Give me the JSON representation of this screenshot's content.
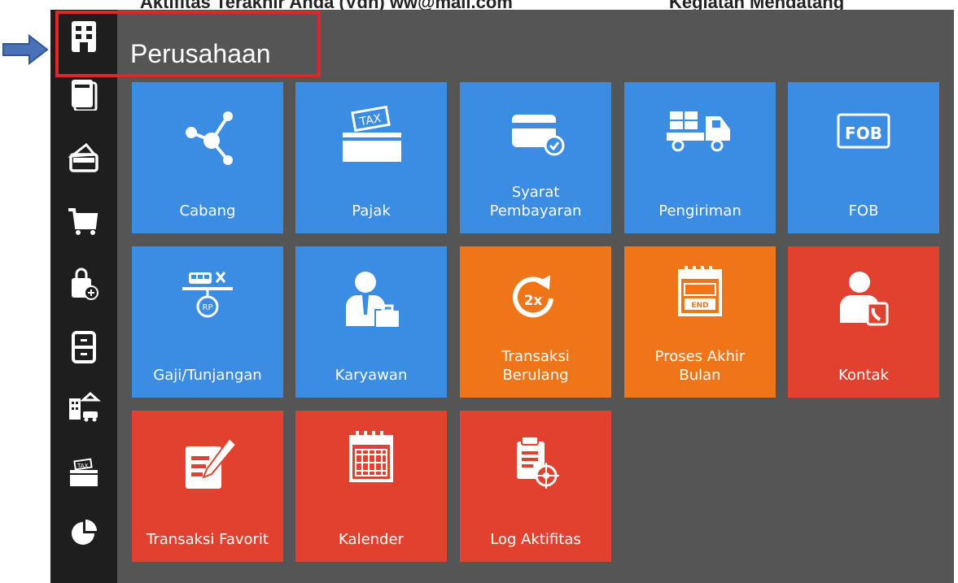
{
  "top_strip": {
    "left_text": "Aktifitas Terakhir Anda (Vdn) ww@mail.com",
    "right_text": "Kegiatan Mendatang"
  },
  "header": {
    "title": "Perusahaan"
  },
  "sidebar": {
    "items": [
      {
        "icon": "building-icon"
      },
      {
        "icon": "ledger-icon"
      },
      {
        "icon": "wallet-icon"
      },
      {
        "icon": "cart-icon"
      },
      {
        "icon": "shopping-bag-add-icon"
      },
      {
        "icon": "cabinet-icon"
      },
      {
        "icon": "fixed-asset-icon"
      },
      {
        "icon": "tax-icon"
      },
      {
        "icon": "pie-chart-icon"
      }
    ]
  },
  "tiles": [
    {
      "label": "Cabang",
      "icon": "share-nodes-icon",
      "color": "#3a8de2"
    },
    {
      "label": "Pajak",
      "icon": "tax-icon",
      "color": "#3a8de2"
    },
    {
      "label": "Syarat Pembayaran",
      "icon": "card-check-icon",
      "color": "#3a8de2"
    },
    {
      "label": "Pengiriman",
      "icon": "truck-icon",
      "color": "#3a8de2"
    },
    {
      "label": "FOB",
      "icon": "fob-icon",
      "color": "#3a8de2"
    },
    {
      "label": "Gaji/Tunjangan",
      "icon": "salary-icon",
      "color": "#3a8de2"
    },
    {
      "label": "Karyawan",
      "icon": "employee-icon",
      "color": "#3a8de2"
    },
    {
      "label": "Transaksi Berulang",
      "icon": "recurring-icon",
      "color": "#f07418"
    },
    {
      "label": "Proses Akhir Bulan",
      "icon": "month-end-icon",
      "color": "#f07418"
    },
    {
      "label": "Kontak",
      "icon": "contact-icon",
      "color": "#e2412f"
    },
    {
      "label": "Transaksi Favorit",
      "icon": "edit-icon",
      "color": "#e2412f"
    },
    {
      "label": "Kalender",
      "icon": "calendar-icon",
      "color": "#e2412f"
    },
    {
      "label": "Log Aktifitas",
      "icon": "activity-log-icon",
      "color": "#e2412f"
    }
  ],
  "tile_icon_texts": {
    "tax": "TAX",
    "fob": "FOB",
    "rp": "RP",
    "recurring": "2x",
    "end": "END"
  }
}
